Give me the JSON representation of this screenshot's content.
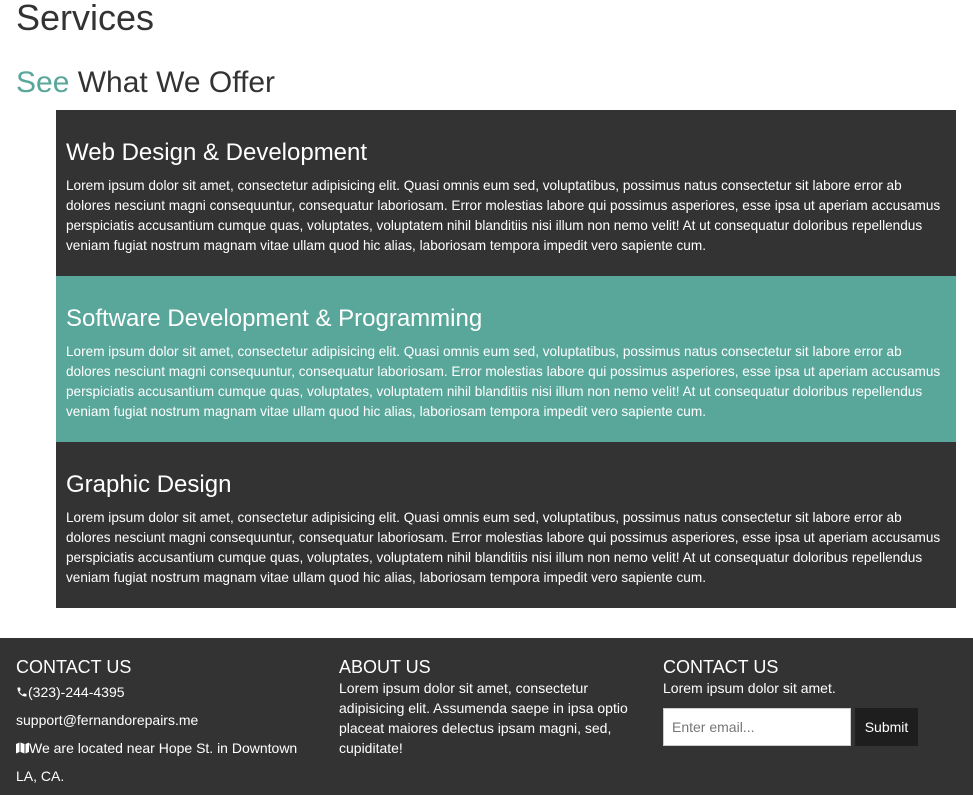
{
  "page": {
    "title": "Services",
    "offer_accent": "See",
    "offer_rest": " What We Offer"
  },
  "services": [
    {
      "title": "Web Design & Development",
      "text": "Lorem ipsum dolor sit amet, consectetur adipisicing elit. Quasi omnis eum sed, voluptatibus, possimus natus consectetur sit labore error ab dolores nesciunt magni consequuntur, consequatur laboriosam. Error molestias labore qui possimus asperiores, esse ipsa ut aperiam accusamus perspiciatis accusantium cumque quas, voluptates, voluptatem nihil blanditiis nisi illum non nemo velit! At ut consequatur doloribus repellendus veniam fugiat nostrum magnam vitae ullam quod hic alias, laboriosam tempora impedit vero sapiente cum."
    },
    {
      "title": "Software Development & Programming",
      "text": "Lorem ipsum dolor sit amet, consectetur adipisicing elit. Quasi omnis eum sed, voluptatibus, possimus natus consectetur sit labore error ab dolores nesciunt magni consequuntur, consequatur laboriosam. Error molestias labore qui possimus asperiores, esse ipsa ut aperiam accusamus perspiciatis accusantium cumque quas, voluptates, voluptatem nihil blanditiis nisi illum non nemo velit! At ut consequatur doloribus repellendus veniam fugiat nostrum magnam vitae ullam quod hic alias, laboriosam tempora impedit vero sapiente cum."
    },
    {
      "title": "Graphic Design",
      "text": "Lorem ipsum dolor sit amet, consectetur adipisicing elit. Quasi omnis eum sed, voluptatibus, possimus natus consectetur sit labore error ab dolores nesciunt magni consequuntur, consequatur laboriosam. Error molestias labore qui possimus asperiores, esse ipsa ut aperiam accusamus perspiciatis accusantium cumque quas, voluptates, voluptatem nihil blanditiis nisi illum non nemo velit! At ut consequatur doloribus repellendus veniam fugiat nostrum magnam vitae ullam quod hic alias, laboriosam tempora impedit vero sapiente cum."
    }
  ],
  "footer": {
    "contact": {
      "heading": "CONTACT US",
      "phone": "(323)-244-4395",
      "email": "support@fernandorepairs.me",
      "location": "We are located near Hope St. in Downtown LA, CA."
    },
    "about": {
      "heading": "ABOUT US",
      "text": "Lorem ipsum dolor sit amet, consectetur adipisicing elit. Assumenda saepe in ipsa optio placeat maiores delectus ipsam magni, sed, cupiditate!"
    },
    "newsletter": {
      "heading": "CONTACT US",
      "text": "Lorem ipsum dolor sit amet.",
      "email_placeholder": "Enter email...",
      "submit_label": "Submit"
    }
  },
  "icons": {
    "phone": "phone-icon",
    "location": "map-icon"
  },
  "colors": {
    "accent": "#58a79a",
    "dark_panel": "#333333",
    "footer_bg": "#333333",
    "submit_bg": "#1e1e1e"
  }
}
